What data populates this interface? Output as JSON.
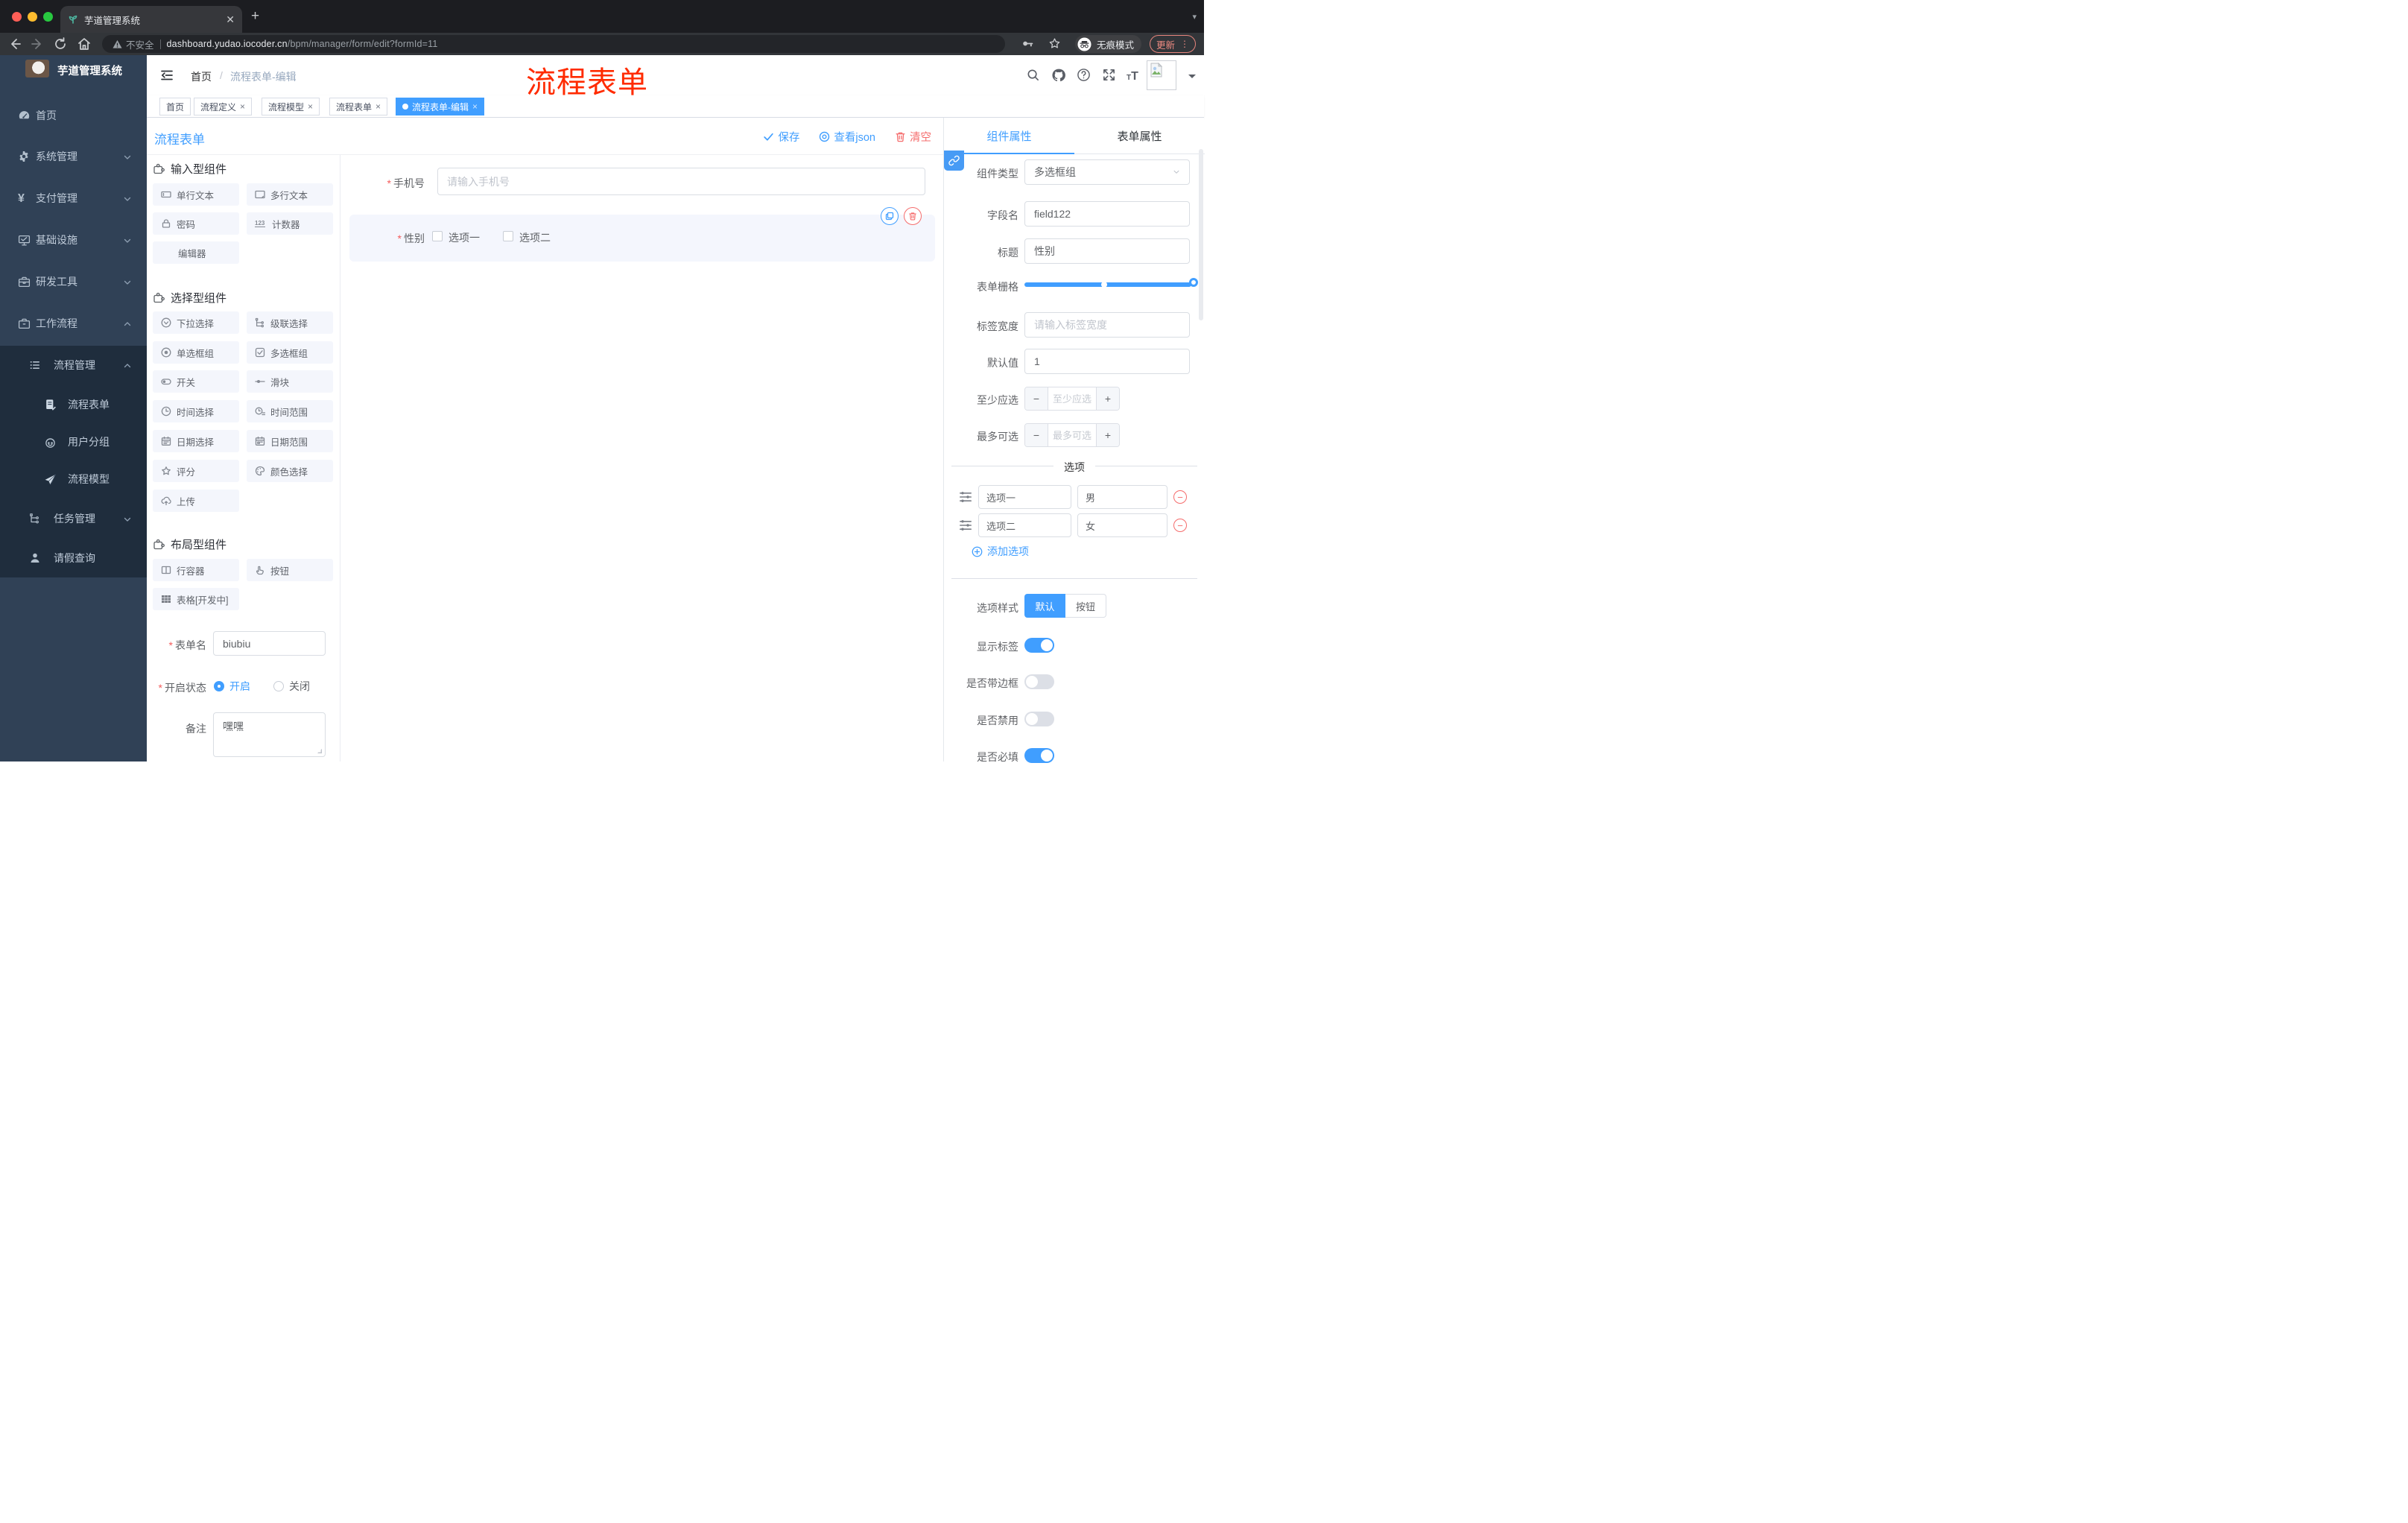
{
  "colors": {
    "accent": "#409eff",
    "danger": "#f56c6c",
    "annotation_red": "#ff2b00",
    "sidebar_bg": "#304156",
    "submenu_bg": "#1f2d3d"
  },
  "browser": {
    "tab_title": "芋道管理系统",
    "security_label": "不安全",
    "url_host": "dashboard.yudao.iocoder.cn",
    "url_path": "/bpm/manager/form/edit?formId=11",
    "incognito_label": "无痕模式",
    "update_label": "更新"
  },
  "sidebar": {
    "logo_title": "芋道管理系统",
    "items": [
      {
        "label": "首页"
      },
      {
        "label": "系统管理"
      },
      {
        "label": "支付管理"
      },
      {
        "label": "基础设施"
      },
      {
        "label": "研发工具"
      },
      {
        "label": "工作流程"
      }
    ],
    "workflow": {
      "group_label": "流程管理",
      "children": [
        {
          "label": "流程表单"
        },
        {
          "label": "用户分组"
        },
        {
          "label": "流程模型"
        }
      ],
      "task_label": "任务管理",
      "leave_label": "请假查询"
    }
  },
  "navbar": {
    "breadcrumb": [
      "首页",
      "流程表单-编辑"
    ],
    "annotation": "流程表单"
  },
  "tags": [
    {
      "label": "首页"
    },
    {
      "label": "流程定义"
    },
    {
      "label": "流程模型"
    },
    {
      "label": "流程表单"
    },
    {
      "label": "流程表单-编辑"
    }
  ],
  "editor": {
    "title": "流程表单",
    "actions": {
      "save": "保存",
      "view_json": "查看json",
      "clear": "清空"
    },
    "palette": {
      "sections": [
        {
          "title": "输入型组件",
          "items": [
            {
              "label": "单行文本"
            },
            {
              "label": "多行文本"
            },
            {
              "label": "密码"
            },
            {
              "label": "计数器"
            },
            {
              "label": "编辑器"
            }
          ]
        },
        {
          "title": "选择型组件",
          "items": [
            {
              "label": "下拉选择"
            },
            {
              "label": "级联选择"
            },
            {
              "label": "单选框组"
            },
            {
              "label": "多选框组"
            },
            {
              "label": "开关"
            },
            {
              "label": "滑块"
            },
            {
              "label": "时间选择"
            },
            {
              "label": "时间范围"
            },
            {
              "label": "日期选择"
            },
            {
              "label": "日期范围"
            },
            {
              "label": "评分"
            },
            {
              "label": "颜色选择"
            },
            {
              "label": "上传"
            }
          ]
        },
        {
          "title": "布局型组件",
          "items": [
            {
              "label": "行容器"
            },
            {
              "label": "按钮"
            },
            {
              "label": "表格[开发中]"
            }
          ]
        }
      ]
    },
    "settings": {
      "form_name_label": "表单名",
      "form_name_value": "biubiu",
      "status_label": "开启状态",
      "status_on": "开启",
      "status_off": "关闭",
      "remark_label": "备注",
      "remark_value": "嘿嘿"
    },
    "canvas": {
      "phone_label": "手机号",
      "phone_placeholder": "请输入手机号",
      "gender_label": "性别",
      "gender_options": [
        "选项一",
        "选项二"
      ]
    }
  },
  "inspector": {
    "tabs": [
      "组件属性",
      "表单属性"
    ],
    "rows": {
      "component_type_label": "组件类型",
      "component_type_value": "多选框组",
      "field_name_label": "字段名",
      "field_name_value": "field122",
      "title_label": "标题",
      "title_value": "性别",
      "grid_label": "表单栅格",
      "label_width_label": "标签宽度",
      "label_width_placeholder": "请输入标签宽度",
      "default_label": "默认值",
      "default_value": "1",
      "min_label": "至少应选",
      "min_placeholder": "至少应选",
      "max_label": "最多可选",
      "max_placeholder": "最多可选"
    },
    "options_title": "选项",
    "options": [
      {
        "label": "选项一",
        "value": "男"
      },
      {
        "label": "选项二",
        "value": "女"
      }
    ],
    "add_option_label": "添加选项",
    "style_label": "选项样式",
    "style_default": "默认",
    "style_button": "按钮",
    "switch_show_label": "显示标签",
    "switch_border": "是否带边框",
    "switch_disabled": "是否禁用",
    "switch_required": "是否必填"
  }
}
